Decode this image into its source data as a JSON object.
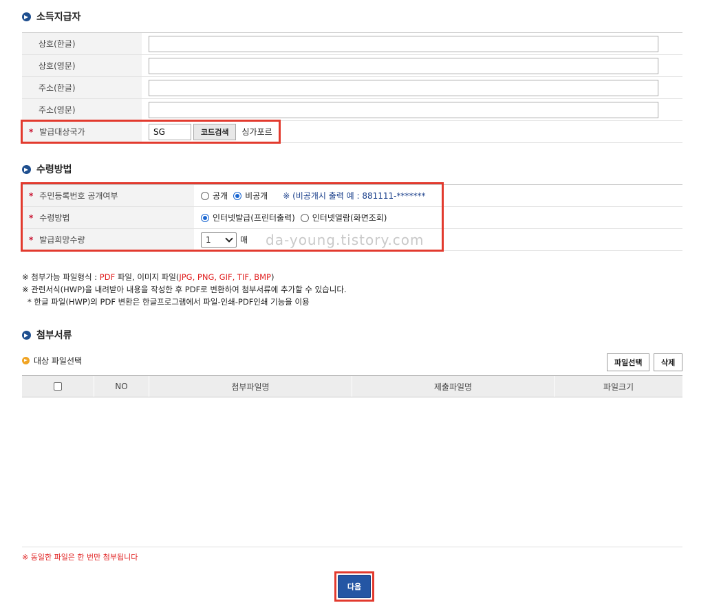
{
  "payer_section": {
    "title": "소득지급자",
    "rows": [
      {
        "label": "상호(한글)",
        "value": ""
      },
      {
        "label": "상호(영문)",
        "value": ""
      },
      {
        "label": "주소(한글)",
        "value": ""
      },
      {
        "label": "주소(영문)",
        "value": ""
      }
    ],
    "country": {
      "label": "발급대상국가",
      "value": "SG",
      "button": "코드검색",
      "name": "싱가포르"
    }
  },
  "receive_section": {
    "title": "수령방법",
    "id_disclosure": {
      "label": "주민등록번호 공개여부",
      "options": [
        "공개",
        "비공개"
      ],
      "selected": "비공개",
      "note": "※ (비공개시 출력 예 : 881111-*******"
    },
    "method": {
      "label": "수령방법",
      "options": [
        "인터넷발급(프린터출력)",
        "인터넷열람(화면조회)"
      ],
      "selected": "인터넷발급(프린터출력)"
    },
    "quantity": {
      "label": "발급희망수량",
      "value": "1",
      "unit": "매"
    },
    "watermark": "da-young.tistory.com"
  },
  "info": {
    "line1_prefix": "※ 첨부가능 파일형식 : ",
    "line1_pdf": "PDF",
    "line1_mid": " 파일, 이미지 파일(",
    "line1_formats": "JPG, PNG, GIF, TIF, BMP",
    "line1_suffix": ")",
    "line2": "※ 관련서식(HWP)을 내려받아 내용을 작성한 후 PDF로 변환하여 첨부서류에 추가할 수 있습니다.",
    "line3": "* 한글 파일(HWP)의 PDF 변환은 한글프로그램에서 파일-인쇄-PDF인쇄 기능을 이용"
  },
  "attach_section": {
    "title": "첨부서류",
    "sub_title": "대상 파일선택",
    "select_button": "파일선택",
    "delete_button": "삭제",
    "columns": [
      "NO",
      "첨부파일명",
      "제출파일명",
      "파일크기"
    ]
  },
  "footnote": "※ 동일한 파일은 한 번만 첨부됩니다",
  "next_button": "다음",
  "colors": {
    "accent_blue": "#2456a4",
    "highlight_red": "#e23a2e",
    "required_star": "#c8102e"
  }
}
